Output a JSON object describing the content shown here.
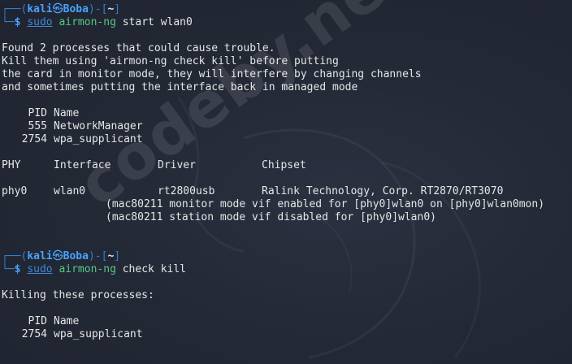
{
  "theme": {
    "background": "#232835",
    "prompt_blue": "#4aa3ff",
    "command_green": "#57c786",
    "text": "#e6e6e6"
  },
  "watermark": "codeby.net",
  "prompt": {
    "open": "┌──(",
    "user": "kali",
    "skull_icon": "㉿",
    "host": "Boba",
    "mid": ")-[",
    "path": "~",
    "close": "]",
    "second_line": "└─",
    "dollar": "$"
  },
  "block1": {
    "command": {
      "sudo": "sudo",
      "name": "airmon-ng",
      "args": " start wlan0"
    },
    "warning_lines": [
      "Found 2 processes that could cause trouble.",
      "Kill them using 'airmon-ng check kill' before putting",
      "the card in monitor mode, they will interfere by changing channels",
      "and sometimes putting the interface back in managed mode"
    ],
    "proc_header": {
      "pid": "PID",
      "name": "Name"
    },
    "processes": [
      {
        "pid": "555",
        "name": "NetworkManager"
      },
      {
        "pid": "2754",
        "name": "wpa_supplicant"
      }
    ],
    "table_header": {
      "phy": "PHY",
      "interface": "Interface",
      "driver": "Driver",
      "chipset": "Chipset"
    },
    "table_row": {
      "phy": "phy0",
      "interface": "wlan0",
      "driver": "rt2800usb",
      "chipset": "Ralink Technology, Corp. RT2870/RT3070"
    },
    "notes": [
      "(mac80211 monitor mode vif enabled for [phy0]wlan0 on [phy0]wlan0mon)",
      "(mac80211 station mode vif disabled for [phy0]wlan0)"
    ]
  },
  "block2": {
    "command": {
      "sudo": "sudo",
      "name": "airmon-ng",
      "args": " check kill"
    },
    "message": "Killing these processes:",
    "proc_header": {
      "pid": "PID",
      "name": "Name"
    },
    "processes": [
      {
        "pid": "2754",
        "name": "wpa_supplicant"
      }
    ]
  }
}
